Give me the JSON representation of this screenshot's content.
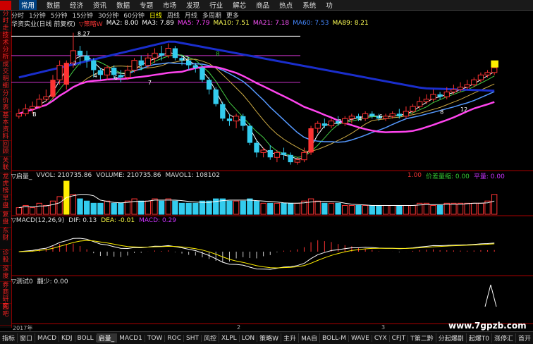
{
  "menu": {
    "items": [
      "常用",
      "数据",
      "经济",
      "资讯",
      "数据",
      "专题",
      "市场",
      "发现",
      "行业",
      "解芯",
      "商品",
      "热点",
      "系统",
      "功"
    ],
    "active_index": 0
  },
  "left_tabs": [
    "分时走势",
    "技术分析",
    "成交明细",
    "分价表",
    "基本资料",
    "回顾",
    "关联",
    "龙虎榜",
    "早盘",
    "复盘",
    "东财",
    "诊股",
    "深度",
    "券商研究",
    "图吧"
  ],
  "periods": [
    "分时",
    "1分钟",
    "5分钟",
    "15分钟",
    "30分钟",
    "60分钟",
    "日线",
    "周线",
    "月线",
    "多周期",
    "更多"
  ],
  "active_period": "日线",
  "ma_legend": {
    "stock": "华资实业(日线 前复权)",
    "indicator": "▽策略W",
    "items": [
      {
        "label": "MA2: 8.00",
        "color": "#ffffff"
      },
      {
        "label": "MA3: 7.89",
        "color": "#ffffff"
      },
      {
        "label": "MA5: 7.79",
        "color": "#ff44ff"
      },
      {
        "label": "MA10: 7.51",
        "color": "#ffff55"
      },
      {
        "label": "MA21: 7.18",
        "color": "#ff55ff"
      },
      {
        "label": "MA60: 7.53",
        "color": "#4488ff"
      },
      {
        "label": "MA89: 8.21",
        "color": "#ffff55"
      }
    ],
    "price_high": "8.27"
  },
  "volume_legend": {
    "title": "▽启量_",
    "vvol": "VVOL: 210735.86",
    "volume": "VOLUME: 210735.86",
    "mavol": "MAVOL1: 108102",
    "right_ratio": "1.00",
    "right_label": "价差量缩: 0.00",
    "right_flat": "平量: 0.00"
  },
  "macd_legend": {
    "title": "▽MACD(12,26,9)",
    "dif": "DIF: 0.13",
    "dea": "DEA: -0.01",
    "macd": "MACD: 0.29"
  },
  "test_legend": {
    "title": "▽测试0",
    "value": "翻少: 0.00"
  },
  "time_axis": [
    "2017年",
    "2",
    "3"
  ],
  "bottom_tabs": [
    "指标",
    "窗口",
    "MACD",
    "KDJ",
    "BOLL",
    "启量_",
    "MACD1",
    "TOW",
    "ROC",
    "SHT",
    "风控",
    "XLPL",
    "LON",
    "策略W",
    "主升",
    "MA自",
    "BOLL-M",
    "WAVE",
    "CYX",
    "CFJT",
    "T第二黔",
    "分起爆剧",
    "起爆T0",
    "涨停汇",
    "首开",
    "分"
  ],
  "bottom_active": "启量_",
  "watermark": "www.7gpzb.com",
  "chart_data": {
    "type": "candlestick",
    "candles": [
      {
        "o": 6.55,
        "c": 6.6,
        "h": 6.7,
        "l": 6.5
      },
      {
        "o": 6.6,
        "c": 6.7,
        "h": 6.8,
        "l": 6.55
      },
      {
        "o": 6.7,
        "c": 6.75,
        "h": 6.85,
        "l": 6.6
      },
      {
        "o": 6.75,
        "c": 6.9,
        "h": 7.0,
        "l": 6.7
      },
      {
        "o": 6.9,
        "c": 6.95,
        "h": 7.1,
        "l": 6.85
      },
      {
        "o": 6.95,
        "c": 7.3,
        "h": 7.4,
        "l": 6.9
      },
      {
        "o": 7.3,
        "c": 7.6,
        "h": 7.7,
        "l": 7.2
      },
      {
        "o": 7.2,
        "c": 7.65,
        "h": 7.7,
        "l": 7.1
      },
      {
        "o": 7.65,
        "c": 7.9,
        "h": 8.27,
        "l": 7.55
      },
      {
        "o": 7.9,
        "c": 7.8,
        "h": 8.0,
        "l": 7.6
      },
      {
        "o": 7.8,
        "c": 7.7,
        "h": 7.9,
        "l": 7.55
      },
      {
        "o": 7.7,
        "c": 7.5,
        "h": 7.75,
        "l": 7.35
      },
      {
        "o": 7.5,
        "c": 7.4,
        "h": 7.55,
        "l": 7.3
      },
      {
        "o": 7.4,
        "c": 7.55,
        "h": 7.6,
        "l": 7.3
      },
      {
        "o": 7.55,
        "c": 7.4,
        "h": 7.6,
        "l": 7.3
      },
      {
        "o": 7.4,
        "c": 7.35,
        "h": 7.5,
        "l": 7.25
      },
      {
        "o": 7.35,
        "c": 7.5,
        "h": 7.6,
        "l": 7.3
      },
      {
        "o": 7.5,
        "c": 7.7,
        "h": 7.75,
        "l": 7.45
      },
      {
        "o": 7.7,
        "c": 7.6,
        "h": 7.8,
        "l": 7.5
      },
      {
        "o": 7.6,
        "c": 7.75,
        "h": 7.85,
        "l": 7.55
      },
      {
        "o": 7.75,
        "c": 7.85,
        "h": 7.95,
        "l": 7.65
      },
      {
        "o": 7.85,
        "c": 7.8,
        "h": 8.0,
        "l": 7.7
      },
      {
        "o": 7.8,
        "c": 7.95,
        "h": 8.05,
        "l": 7.75
      },
      {
        "o": 7.95,
        "c": 7.75,
        "h": 8.0,
        "l": 7.7
      },
      {
        "o": 7.75,
        "c": 7.7,
        "h": 7.8,
        "l": 7.6
      },
      {
        "o": 7.7,
        "c": 7.6,
        "h": 7.75,
        "l": 7.5
      },
      {
        "o": 7.6,
        "c": 7.55,
        "h": 7.65,
        "l": 7.45
      },
      {
        "o": 7.55,
        "c": 7.3,
        "h": 7.6,
        "l": 7.25
      },
      {
        "o": 7.3,
        "c": 7.1,
        "h": 7.35,
        "l": 7.0
      },
      {
        "o": 7.1,
        "c": 6.8,
        "h": 7.15,
        "l": 6.75
      },
      {
        "o": 6.8,
        "c": 6.5,
        "h": 6.85,
        "l": 6.45
      },
      {
        "o": 6.5,
        "c": 6.45,
        "h": 6.6,
        "l": 6.35
      },
      {
        "o": 6.45,
        "c": 6.55,
        "h": 6.6,
        "l": 6.3
      },
      {
        "o": 6.55,
        "c": 6.35,
        "h": 6.6,
        "l": 6.25
      },
      {
        "o": 6.35,
        "c": 6.0,
        "h": 6.4,
        "l": 5.95
      },
      {
        "o": 6.0,
        "c": 5.8,
        "h": 6.05,
        "l": 5.7
      },
      {
        "o": 5.8,
        "c": 5.85,
        "h": 5.9,
        "l": 5.7
      },
      {
        "o": 5.85,
        "c": 5.7,
        "h": 5.95,
        "l": 5.65
      },
      {
        "o": 5.7,
        "c": 5.8,
        "h": 5.85,
        "l": 5.6
      },
      {
        "o": 5.8,
        "c": 5.75,
        "h": 5.9,
        "l": 5.65
      },
      {
        "o": 5.75,
        "c": 5.6,
        "h": 5.8,
        "l": 5.55
      },
      {
        "o": 5.6,
        "c": 5.65,
        "h": 5.7,
        "l": 5.55
      },
      {
        "o": 5.65,
        "c": 5.8,
        "h": 5.9,
        "l": 5.6
      },
      {
        "o": 5.8,
        "c": 6.3,
        "h": 6.35,
        "l": 5.75
      },
      {
        "o": 6.3,
        "c": 6.4,
        "h": 6.45,
        "l": 6.2
      },
      {
        "o": 6.4,
        "c": 6.35,
        "h": 6.5,
        "l": 6.3
      },
      {
        "o": 6.35,
        "c": 6.45,
        "h": 6.5,
        "l": 6.3
      },
      {
        "o": 6.45,
        "c": 6.4,
        "h": 6.55,
        "l": 6.35
      },
      {
        "o": 6.4,
        "c": 6.5,
        "h": 6.55,
        "l": 6.35
      },
      {
        "o": 6.5,
        "c": 6.55,
        "h": 6.6,
        "l": 6.4
      },
      {
        "o": 6.55,
        "c": 6.5,
        "h": 6.6,
        "l": 6.45
      },
      {
        "o": 6.5,
        "c": 6.6,
        "h": 6.65,
        "l": 6.45
      },
      {
        "o": 6.6,
        "c": 6.55,
        "h": 6.65,
        "l": 6.5
      },
      {
        "o": 6.55,
        "c": 6.5,
        "h": 6.6,
        "l": 6.45
      },
      {
        "o": 6.5,
        "c": 6.55,
        "h": 6.6,
        "l": 6.45
      },
      {
        "o": 6.55,
        "c": 6.6,
        "h": 6.65,
        "l": 6.5
      },
      {
        "o": 6.6,
        "c": 6.55,
        "h": 6.7,
        "l": 6.5
      },
      {
        "o": 6.55,
        "c": 6.65,
        "h": 6.75,
        "l": 6.5
      },
      {
        "o": 6.65,
        "c": 6.75,
        "h": 6.8,
        "l": 6.6
      },
      {
        "o": 6.75,
        "c": 6.85,
        "h": 6.95,
        "l": 6.7
      },
      {
        "o": 6.85,
        "c": 6.9,
        "h": 7.0,
        "l": 6.8
      },
      {
        "o": 6.9,
        "c": 7.0,
        "h": 7.1,
        "l": 6.85
      },
      {
        "o": 7.0,
        "c": 6.95,
        "h": 7.05,
        "l": 6.9
      },
      {
        "o": 6.95,
        "c": 7.05,
        "h": 7.15,
        "l": 6.9
      },
      {
        "o": 7.05,
        "c": 7.1,
        "h": 7.2,
        "l": 7.0
      },
      {
        "o": 7.1,
        "c": 7.15,
        "h": 7.25,
        "l": 7.05
      },
      {
        "o": 7.15,
        "c": 7.2,
        "h": 7.3,
        "l": 7.1
      },
      {
        "o": 7.2,
        "c": 7.3,
        "h": 7.35,
        "l": 7.15
      },
      {
        "o": 7.3,
        "c": 7.4,
        "h": 7.45,
        "l": 7.25
      },
      {
        "o": 7.4,
        "c": 7.45,
        "h": 7.5,
        "l": 7.35
      },
      {
        "o": 7.45,
        "c": 7.55,
        "h": 7.6,
        "l": 7.4
      }
    ],
    "volume": [
      3,
      4,
      3,
      5,
      4,
      6,
      8,
      15,
      9,
      7,
      6,
      5,
      5,
      6,
      5,
      5,
      6,
      7,
      6,
      6,
      7,
      6,
      7,
      6,
      5,
      5,
      5,
      6,
      6,
      7,
      7,
      6,
      6,
      6,
      7,
      6,
      5,
      5,
      5,
      5,
      5,
      5,
      6,
      7,
      6,
      5,
      5,
      5,
      4,
      4,
      4,
      4,
      4,
      4,
      4,
      4,
      4,
      4,
      4,
      5,
      5,
      4,
      4,
      5,
      5,
      5,
      5,
      5,
      5,
      6,
      9
    ],
    "labels": [
      "B",
      "2",
      "4",
      "6",
      "7",
      "12",
      "8",
      "2",
      "4",
      "6",
      "8",
      "12"
    ],
    "price_high_label": "8.27"
  }
}
